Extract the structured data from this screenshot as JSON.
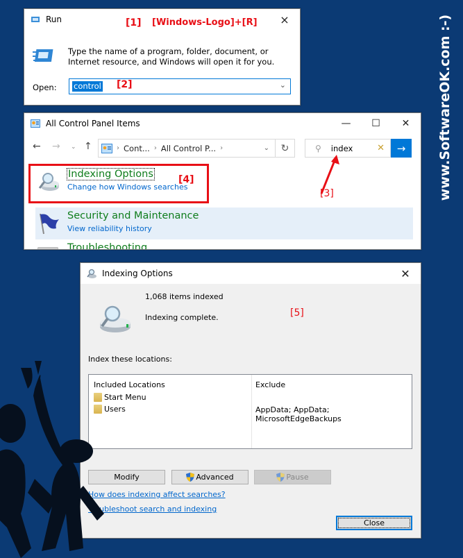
{
  "run_dialog": {
    "title": "Run",
    "annotation_step": "[1]",
    "annotation_hotkey": "[Windows-Logo]+[R]",
    "description": "Type the name of a program, folder, document, or Internet resource, and Windows will open it for you.",
    "open_label": "Open:",
    "open_value": "control",
    "annotation_value": "[2]",
    "close_icon": "×"
  },
  "control_panel": {
    "title": "All Control Panel Items",
    "breadcrumb": [
      "Cont...",
      "All Control P..."
    ],
    "search_value": "index",
    "annotation_search": "[3]",
    "annotation_item": "[4]",
    "items": [
      {
        "title": "Indexing Options",
        "subtitle": "Change how Windows searches"
      },
      {
        "title": "Security and Maintenance",
        "subtitle": "View reliability history"
      },
      {
        "title": "Troubleshooting",
        "subtitle": ""
      }
    ]
  },
  "indexing_options": {
    "title": "Indexing Options",
    "annotation": "[5]",
    "items_indexed": "1,068 items indexed",
    "status": "Indexing complete.",
    "locations_label": "Index these locations:",
    "columns": [
      "Included Locations",
      "Exclude"
    ],
    "rows": [
      {
        "location": "Start Menu",
        "exclude": ""
      },
      {
        "location": "Users",
        "exclude": "AppData; AppData; MicrosoftEdgeBackups"
      }
    ],
    "buttons": {
      "modify": "Modify",
      "advanced": "Advanced",
      "pause": "Pause",
      "close": "Close"
    },
    "links": [
      "How does indexing affect searches?",
      "Troubleshoot search and indexing"
    ]
  },
  "watermark": "www.SoftwareOK.com :-)",
  "colors": {
    "background": "#0b3a74",
    "annotation": "#e80f16",
    "accent": "#0078d7",
    "item_title": "#0f7d1c",
    "link": "#0066cc"
  }
}
